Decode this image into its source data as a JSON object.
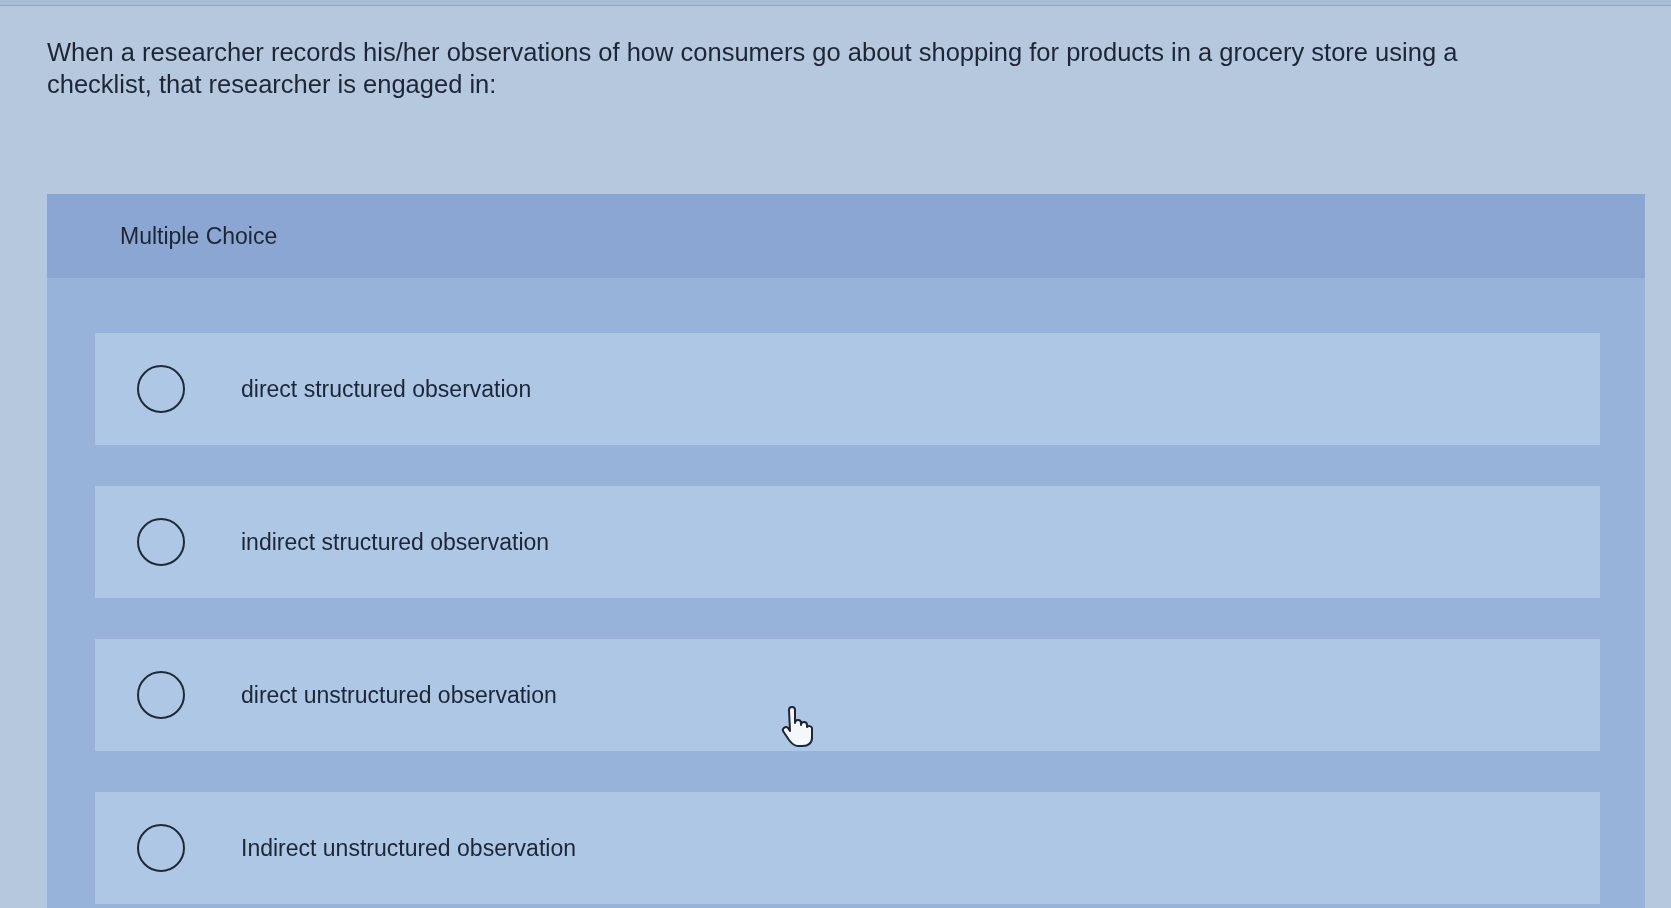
{
  "question": "When a researcher records his/her observations of how consumers go about shopping for products in a grocery store using a checklist, that researcher is engaged in:",
  "panel": {
    "header": "Multiple Choice",
    "options": [
      {
        "label": "direct structured observation",
        "selected": false
      },
      {
        "label": "indirect structured observation",
        "selected": false
      },
      {
        "label": "direct unstructured observation",
        "selected": false
      },
      {
        "label": "Indirect unstructured observation",
        "selected": false
      }
    ]
  }
}
